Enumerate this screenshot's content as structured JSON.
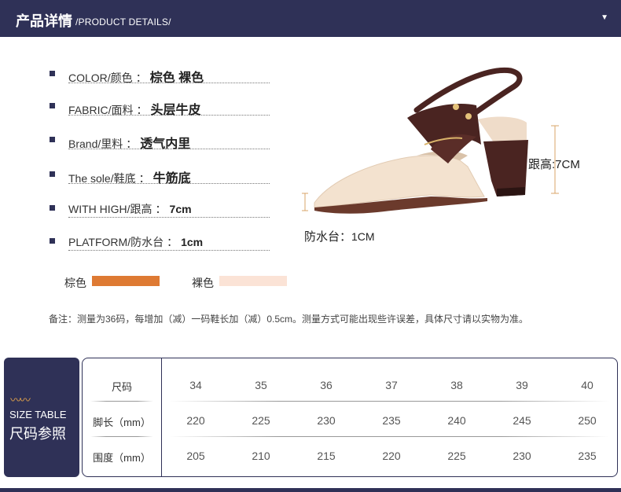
{
  "header": {
    "title_cn": "产品详情",
    "title_en": "/PRODUCT DETAILS/",
    "caret_icon": "caret-down-icon"
  },
  "specs": [
    {
      "label": "COLOR/颜色",
      "sep": "：",
      "value": "棕色 裸色"
    },
    {
      "label": "FABRIC/面料",
      "sep": "：",
      "value": "头层牛皮"
    },
    {
      "label": "Brand/里料",
      "sep": "：",
      "value": "透气内里"
    },
    {
      "label": "The sole/鞋底",
      "sep": "：",
      "value": "牛筋底"
    },
    {
      "label": "WITH HIGH/跟高",
      "sep": "：",
      "value": "7cm"
    },
    {
      "label": "PLATFORM/防水台",
      "sep": "：",
      "value": "1cm"
    }
  ],
  "dimensions": {
    "heel": "跟高:7CM",
    "platform_label": "防水台：",
    "platform_value": "1CM"
  },
  "swatches": [
    {
      "label": "棕色",
      "color": "#de7a33"
    },
    {
      "label": "裸色",
      "color": "#fbe3d6"
    }
  ],
  "note": "备注：测量为36码，每增加（减）一码鞋长加（减）0.5cm。测量方式可能出现些许误差，具体尺寸请以实物为准。",
  "size_badge": {
    "icon": "wave-icon",
    "en": "SIZE TABLE",
    "cn": "尺码参照"
  },
  "size_table": {
    "rows": [
      {
        "label": "尺码",
        "values": [
          "34",
          "35",
          "36",
          "37",
          "38",
          "39",
          "40"
        ]
      },
      {
        "label": "脚长（mm）",
        "values": [
          "220",
          "225",
          "230",
          "235",
          "240",
          "245",
          "250"
        ]
      },
      {
        "label": "围度（mm）",
        "values": [
          "205",
          "210",
          "215",
          "220",
          "225",
          "230",
          "235"
        ]
      }
    ]
  },
  "colors": {
    "brand_navy": "#2f3157",
    "accent_orange": "#de7a33",
    "nude": "#fbe3d6",
    "shoe_brown": "#4a2421",
    "dimension_line": "#d9a56a"
  }
}
